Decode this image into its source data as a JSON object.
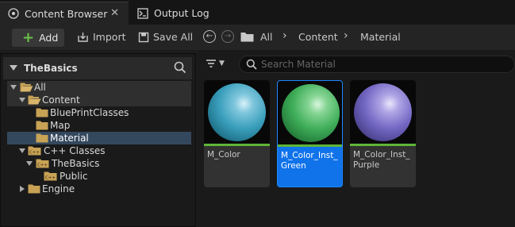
{
  "tabs": [
    {
      "label": "Content Browser",
      "active": true
    },
    {
      "label": "Output Log",
      "active": false
    }
  ],
  "toolbar": {
    "add_label": "Add",
    "import_label": "Import",
    "save_all_label": "Save All"
  },
  "breadcrumb": [
    "All",
    "Content",
    "Material"
  ],
  "sources": {
    "title": "TheBasics",
    "tree": [
      {
        "label": "All",
        "expanded": true
      },
      {
        "label": "Content",
        "expanded": true
      },
      {
        "label": "BluePrintClasses"
      },
      {
        "label": "Map"
      },
      {
        "label": "Material",
        "selected": true
      },
      {
        "label": "C++ Classes",
        "expanded": true
      },
      {
        "label": "TheBasics",
        "expanded": true
      },
      {
        "label": "Public"
      },
      {
        "label": "Engine",
        "expanded": false
      }
    ]
  },
  "search": {
    "placeholder": "Search Material"
  },
  "assets": [
    {
      "name": "M_Color",
      "color": "#3a9fbc",
      "selected": false
    },
    {
      "name": "M_Color_Inst_Green",
      "color": "#3fae5a",
      "selected": true
    },
    {
      "name": "M_Color_Inst_Purple",
      "color": "#7468c4",
      "selected": false
    }
  ],
  "colors": {
    "accent": "#1073ea",
    "add_green": "#6cc24a",
    "folder": "#c8a255",
    "asset_bar": "#5fb537"
  }
}
